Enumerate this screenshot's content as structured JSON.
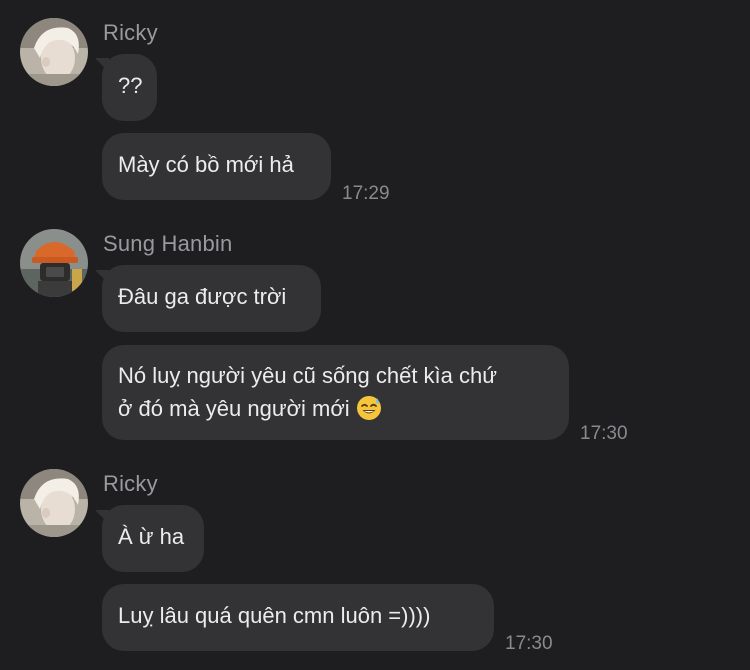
{
  "groups": [
    {
      "sender": "Ricky",
      "avatar": "ricky-avatar-photo",
      "messages": [
        "??",
        "Mày có bồ mới hả"
      ],
      "time": "17:29"
    },
    {
      "sender": "Sung Hanbin",
      "avatar": "sung-hanbin-avatar-photo",
      "messages": [
        "Đâu ga được trời",
        "Nó luỵ người yêu cũ sống chết kìa chứ",
        "ở đó mà yêu người mới"
      ],
      "emoji": "sweat-smile-emoji",
      "time": "17:30"
    },
    {
      "sender": "Ricky",
      "avatar": "ricky-avatar-photo",
      "messages": [
        "À ừ ha",
        "Luỵ lâu quá quên cmn luôn =))))"
      ],
      "time": "17:30"
    }
  ],
  "colors": {
    "background": "#1e1e20",
    "bubble": "#333336",
    "sender_name": "#9a9a9e",
    "timestamp": "#8a8a8e"
  }
}
